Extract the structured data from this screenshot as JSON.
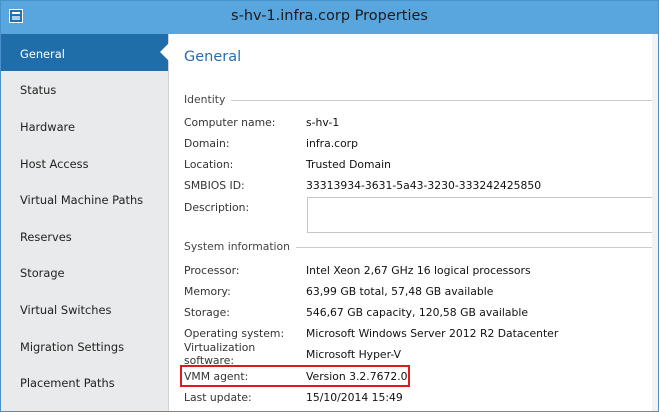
{
  "window": {
    "title": "s-hv-1.infra.corp Properties"
  },
  "sidebar": {
    "items": [
      {
        "label": "General",
        "active": true
      },
      {
        "label": "Status"
      },
      {
        "label": "Hardware"
      },
      {
        "label": "Host Access"
      },
      {
        "label": "Virtual Machine Paths"
      },
      {
        "label": "Reserves"
      },
      {
        "label": "Storage"
      },
      {
        "label": "Virtual Switches"
      },
      {
        "label": "Migration Settings"
      },
      {
        "label": "Placement Paths"
      }
    ]
  },
  "main": {
    "title": "General",
    "identity": {
      "heading": "Identity",
      "fields": [
        {
          "label": "Computer name:",
          "value": "s-hv-1"
        },
        {
          "label": "Domain:",
          "value": "infra.corp"
        },
        {
          "label": "Location:",
          "value": "Trusted Domain"
        },
        {
          "label": "SMBIOS ID:",
          "value": "33313934-3631-5a43-3230-333242425850"
        },
        {
          "label": "Description:",
          "value": ""
        }
      ]
    },
    "system": {
      "heading": "System information",
      "fields": [
        {
          "label": "Processor:",
          "value": "Intel Xeon 2,67 GHz 16 logical processors"
        },
        {
          "label": "Memory:",
          "value": "63,99 GB total, 57,48 GB available"
        },
        {
          "label": "Storage:",
          "value": "546,67 GB capacity, 120,58 GB available"
        },
        {
          "label": "Operating system:",
          "value": "Microsoft Windows Server 2012 R2 Datacenter"
        },
        {
          "label": "Virtualization software:",
          "value": "Microsoft Hyper-V"
        },
        {
          "label": "VMM agent:",
          "value": "Version 3.2.7672.0"
        },
        {
          "label": "Last update:",
          "value": "15/10/2014 15:49"
        }
      ]
    }
  },
  "colors": {
    "titlebar": "#59a6de",
    "sidebar_active": "#1f6eaa",
    "page_title": "#2a6cb0",
    "highlight": "#e0191c"
  }
}
